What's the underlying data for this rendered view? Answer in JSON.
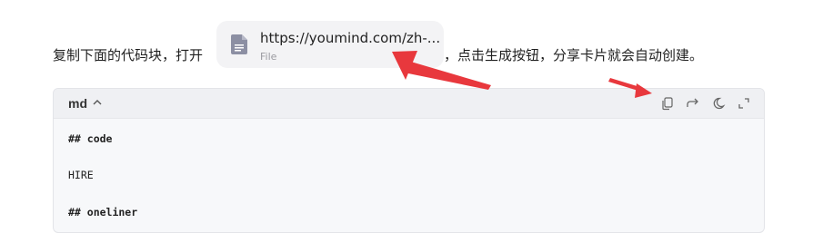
{
  "instruction": {
    "before": "复制下面的代码块，打开",
    "after": "，点击生成按钮，分享卡片就会自动创建。"
  },
  "file_chip": {
    "name": "https://youmind.com/zh-...",
    "type": "File",
    "icon": "document-icon"
  },
  "code_block": {
    "language": "md",
    "toolbar": [
      {
        "name": "copy",
        "icon": "copy-icon"
      },
      {
        "name": "share",
        "icon": "share-icon"
      },
      {
        "name": "theme",
        "icon": "moon-icon"
      },
      {
        "name": "expand",
        "icon": "expand-icon"
      }
    ],
    "lines": [
      {
        "text": "## code",
        "bold": true
      },
      {
        "text": "HIRE",
        "bold": false
      },
      {
        "text": "## oneliner",
        "bold": true
      }
    ]
  },
  "colors": {
    "annotation_arrow": "#e8383d"
  }
}
